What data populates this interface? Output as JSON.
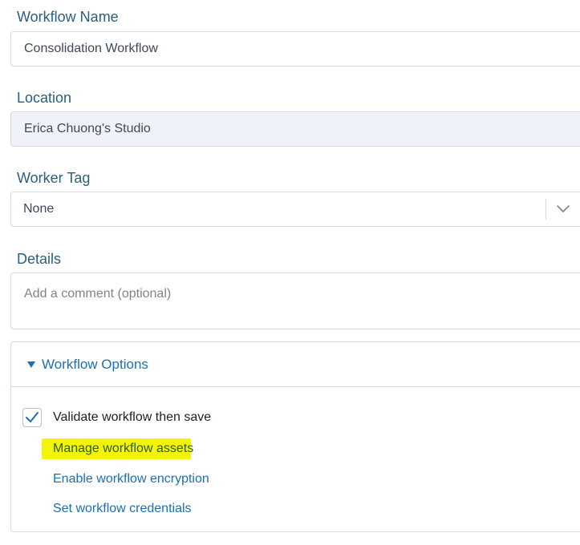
{
  "workflow_name": {
    "label": "Workflow Name",
    "value": "Consolidation Workflow"
  },
  "location": {
    "label": "Location",
    "value": "Erica Chuong's Studio"
  },
  "worker_tag": {
    "label": "Worker Tag",
    "selected": "None"
  },
  "details": {
    "label": "Details",
    "placeholder": "Add a comment (optional)"
  },
  "workflow_options": {
    "title": "Workflow Options",
    "expanded": true,
    "validate_label": "Validate workflow then save",
    "validate_checked": true,
    "links": {
      "manage_assets": "Manage workflow assets",
      "enable_encryption": "Enable workflow encryption",
      "set_credentials": "Set workflow credentials"
    }
  },
  "colors": {
    "label": "#2a5f7e",
    "link": "#1a6fb5",
    "highlight": "#f4f40a",
    "border": "#d6dbe0",
    "readonly_bg": "#eff3f9"
  },
  "icons": {
    "select_chevron": "chevron-down-icon",
    "expand_caret": "caret-down-icon",
    "check": "checkmark-icon"
  }
}
